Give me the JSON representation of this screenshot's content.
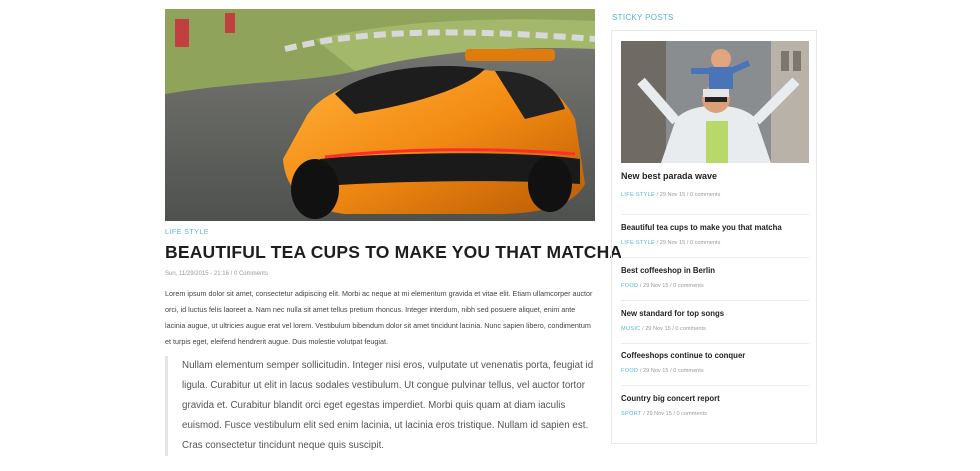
{
  "article": {
    "category": "LIFE STYLE",
    "title": "BEAUTIFUL TEA CUPS TO MAKE YOU THAT MATCHA",
    "meta": "Sun, 11/29/2015 - 21:16 / 0 Comments",
    "body": "Lorem ipsum dolor sit amet, consectetur adipiscing elit. Morbi ac neque at mi elementum gravida et vitae elit. Etiam ullamcorper auctor orci, id luctus felis laoreet a. Nam nec nulla sit amet tellus pretium rhoncus. Integer interdum, nibh sed posuere aliquet, enim ante lacinia augue, ut ultricies augue erat vel lorem. Vestibulum bibendum dolor sit amet tincidunt lacinia. Nunc sapien libero, condimentum et turpis eget, eleifend hendrerit augue. Duis molestie volutpat feugiat.",
    "quote": "Nullam elementum semper sollicitudin. Integer nisi eros, vulputate ut venenatis porta, feugiat id ligula. Curabitur ut elit in lacus sodales vestibulum. Ut congue pulvinar tellus, vel auctor tortor gravida et. Curabitur blandit orci eget egestas imperdiet. Morbi quis quam at diam iaculis euismod. Fusce vestibulum elit sed enim lacinia, ut lacinia eros tristique. Nullam id sapien est. Cras consectetur tincidunt neque quis suscipit."
  },
  "sidebar": {
    "heading": "STICKY POSTS",
    "posts": [
      {
        "title": "New best parada wave",
        "category": "LIFE STYLE",
        "meta": " / 29 Nov 15 / 0 comments"
      },
      {
        "title": "Beautiful tea cups to make you that matcha",
        "category": "LIFE STYLE",
        "meta": " / 29 Nov 15 / 0 comments"
      },
      {
        "title": "Best coffeeshop in Berlin",
        "category": "FOOD",
        "meta": " / 29 Nov 15 / 0 comments"
      },
      {
        "title": "New standard for top songs",
        "category": "MUSIC",
        "meta": " / 29 Nov 15 / 0 comments"
      },
      {
        "title": "Coffeeshops continue to conquer",
        "category": "FOOD",
        "meta": " / 29 Nov 15 / 0 comments"
      },
      {
        "title": "Country big concert report",
        "category": "SPORT",
        "meta": " / 29 Nov 15 / 0 comments"
      }
    ]
  }
}
